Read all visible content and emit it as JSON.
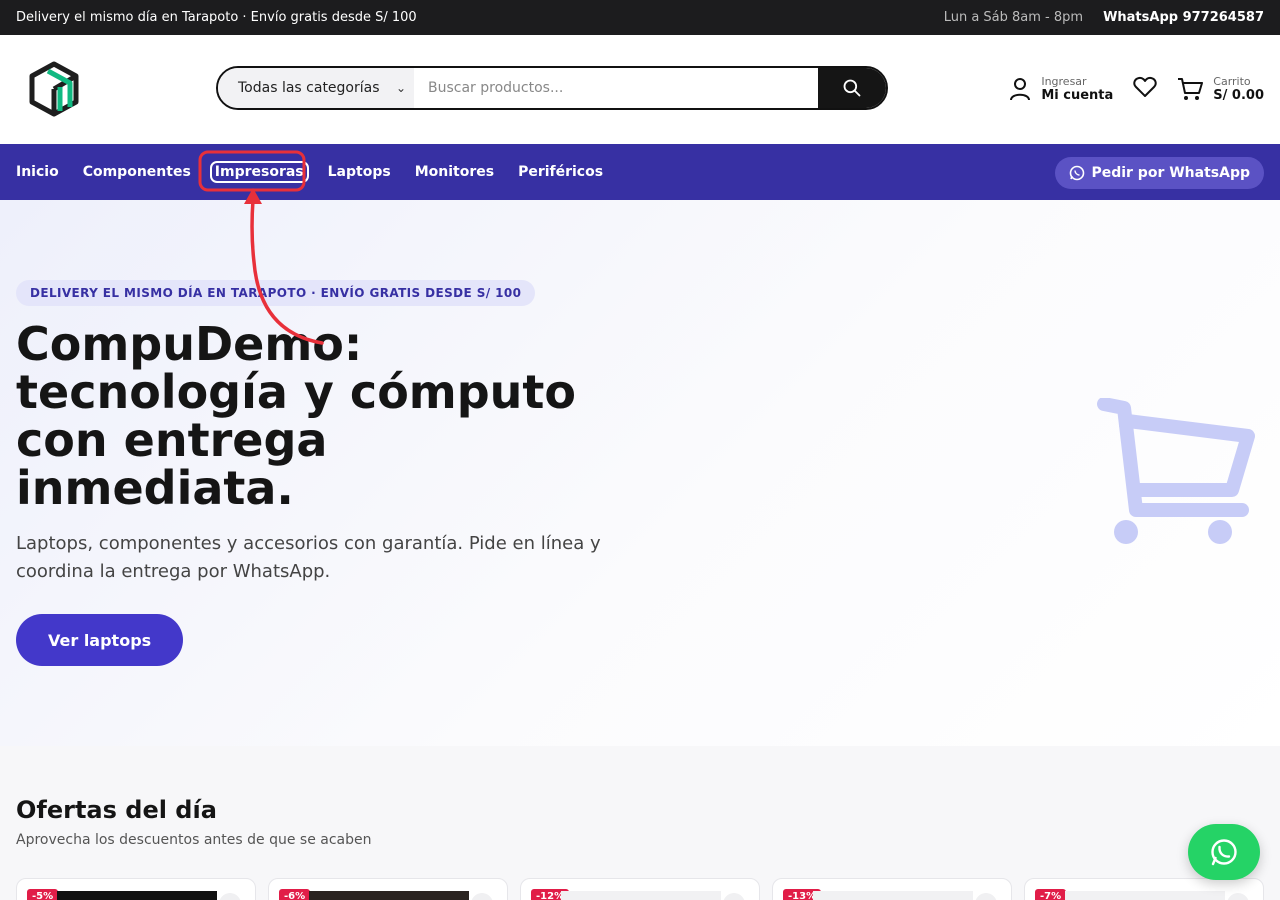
{
  "topbar": {
    "promo": "Delivery el mismo día en Tarapoto · Envío gratis desde S/ 100",
    "hours": "Lun a Sáb 8am - 8pm",
    "whatsapp": "WhatsApp 977264587"
  },
  "header": {
    "logo_icon": "cube-logo-icon",
    "search": {
      "category": "Todas las categorías",
      "placeholder": "Buscar productos..."
    },
    "account": {
      "small": "Ingresar",
      "big": "Mi cuenta"
    },
    "cart": {
      "small": "Carrito",
      "big": "S/ 0.00"
    }
  },
  "nav": {
    "items": [
      {
        "label": "Inicio"
      },
      {
        "label": "Componentes"
      },
      {
        "label": "Impresoras"
      },
      {
        "label": "Laptops"
      },
      {
        "label": "Monitores"
      },
      {
        "label": "Periféricos"
      }
    ],
    "whatsapp_button": "Pedir por WhatsApp"
  },
  "hero": {
    "badge": "DELIVERY EL MISMO DÍA EN TARAPOTO · ENVÍO GRATIS DESDE S/ 100",
    "title": "CompuDemo: tecnología y cómputo con entrega inmediata.",
    "subtitle": "Laptops, componentes y accesorios con garantía. Pide en línea y coordina la entrega por WhatsApp.",
    "cta": "Ver laptops"
  },
  "offers": {
    "title": "Ofertas del día",
    "subtitle": "Aprovecha los descuentos antes de que se acaben",
    "cards": [
      {
        "discount": "-5%"
      },
      {
        "discount": "-6%"
      },
      {
        "discount": "-12%"
      },
      {
        "discount": "-13%"
      },
      {
        "discount": "-7%"
      }
    ]
  },
  "colors": {
    "nav_bg": "#3730a3",
    "cta_bg": "#4338ca",
    "annotation": "#e8303a",
    "whatsapp_green": "#25d366",
    "discount_red": "#e11d48"
  }
}
